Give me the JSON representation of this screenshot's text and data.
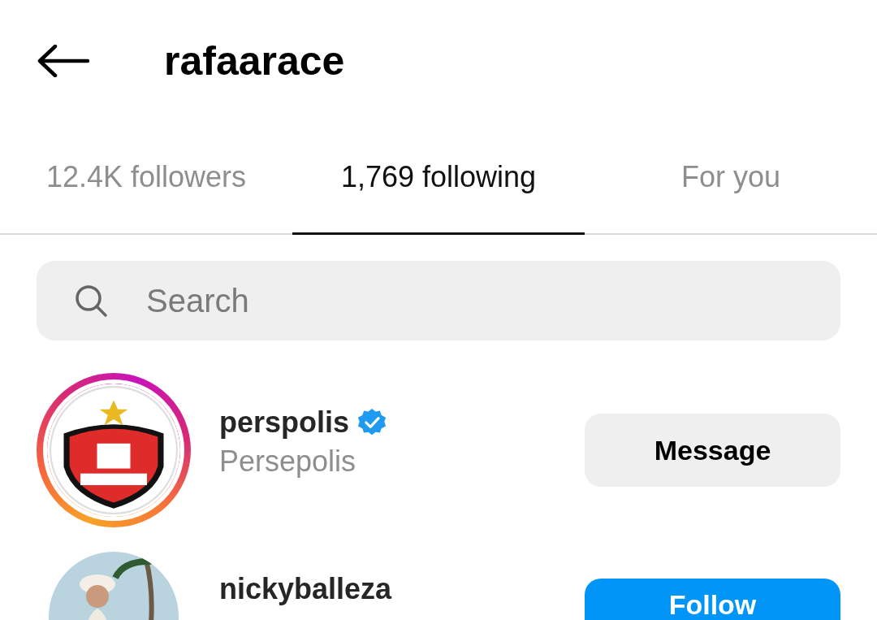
{
  "header": {
    "title": "rafaarace"
  },
  "tabs": [
    {
      "label": "12.4K followers",
      "selected": false
    },
    {
      "label": "1,769 following",
      "selected": true
    },
    {
      "label": "For you",
      "selected": false
    }
  ],
  "search": {
    "placeholder": "Search"
  },
  "users": [
    {
      "username": "perspolis",
      "verified": true,
      "full_name": "Persepolis",
      "story": true,
      "button": {
        "label": "Message",
        "kind": "message"
      }
    },
    {
      "username": "nickyballeza",
      "verified": false,
      "story": false,
      "button": {
        "label": "Follow",
        "kind": "follow"
      }
    }
  ]
}
